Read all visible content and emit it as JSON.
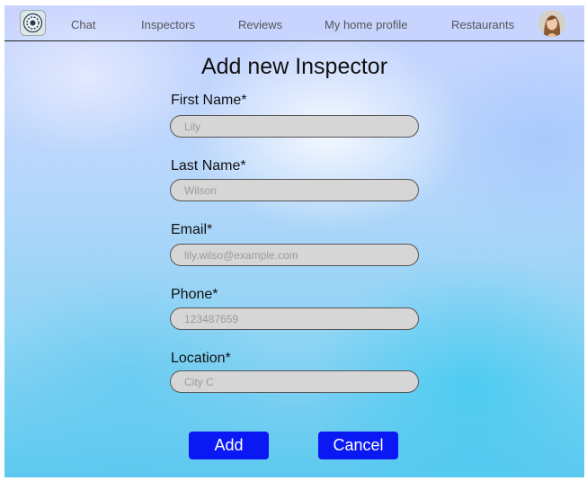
{
  "nav": {
    "items": [
      {
        "label": "Chat"
      },
      {
        "label": "Inspectors"
      },
      {
        "label": "Reviews"
      },
      {
        "label": "My home profile"
      },
      {
        "label": "Restaurants"
      }
    ],
    "logo_icon": "logo-icon",
    "avatar_icon": "user-avatar"
  },
  "form": {
    "title": "Add new Inspector",
    "fields": [
      {
        "label": "First Name*",
        "placeholder": "Lily"
      },
      {
        "label": "Last Name*",
        "placeholder": "Wilson"
      },
      {
        "label": "Email*",
        "placeholder": "lily.wilso@example.com"
      },
      {
        "label": "Phone*",
        "placeholder": "123487659"
      },
      {
        "label": "Location*",
        "placeholder": "City C"
      }
    ],
    "add_label": "Add",
    "cancel_label": "Cancel"
  },
  "colors": {
    "button": "#0a18f4",
    "input_bg": "#d6d6d6"
  }
}
